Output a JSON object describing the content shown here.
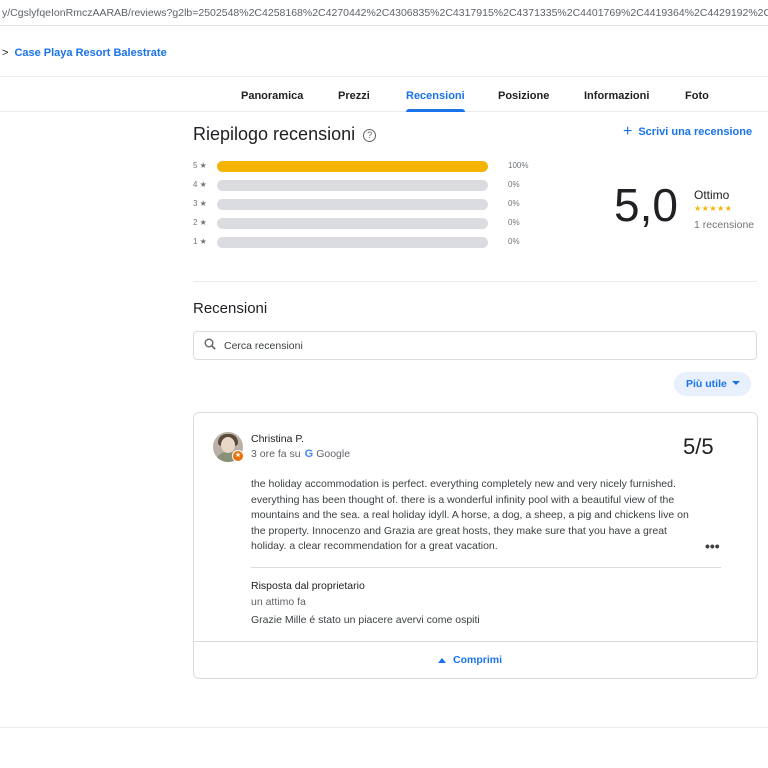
{
  "browser": {
    "url": "y/CgslyfqeIonRmczAARAB/reviews?g2lb=2502548%2C4258168%2C4270442%2C4306835%2C4317915%2C4371335%2C4401769%2C4419364%2C4429192%2C448"
  },
  "breadcrumb": {
    "separator": ">",
    "label": "Case Playa Resort Balestrate"
  },
  "tabs": [
    {
      "label": "Panoramica",
      "active": false
    },
    {
      "label": "Prezzi",
      "active": false
    },
    {
      "label": "Recensioni",
      "active": true
    },
    {
      "label": "Posizione",
      "active": false
    },
    {
      "label": "Informazioni",
      "active": false
    },
    {
      "label": "Foto",
      "active": false
    }
  ],
  "summary": {
    "title": "Riepilogo recensioni",
    "help_icon": "?",
    "write_review_label": "Scrivi una recensione",
    "histogram": [
      {
        "stars": "5",
        "percent": 100,
        "label": "100%"
      },
      {
        "stars": "4",
        "percent": 0,
        "label": "0%"
      },
      {
        "stars": "3",
        "percent": 0,
        "label": "0%"
      },
      {
        "stars": "2",
        "percent": 0,
        "label": "0%"
      },
      {
        "stars": "1",
        "percent": 0,
        "label": "0%"
      }
    ],
    "star_glyph": "★",
    "average": "5,0",
    "rating_word": "Ottimo",
    "stars": "★★★★★",
    "count": "1 recensione"
  },
  "reviews_section": {
    "title": "Recensioni",
    "search_placeholder": "Cerca recensioni",
    "sort_label": "Più utile"
  },
  "review": {
    "author": "Christina P.",
    "time": "3 ore fa su",
    "source_icon": "G",
    "source": "Google",
    "score": "5/5",
    "text": "the holiday accommodation is perfect. everything completely new and very nicely furnished. everything has been thought of. there is a wonderful infinity pool with a beautiful view of the mountains and the sea. a real holiday idyll. A horse, a dog, a sheep, a pig and chickens live on the property. Innocenzo and Grazia are great hosts, they make sure that you have a great holiday. a clear recommendation for a great vacation.",
    "more_icon": "•••",
    "reply_title": "Risposta dal proprietario",
    "reply_time": "un attimo fa",
    "reply_text": "Grazie Mille é stato un piacere avervi come ospiti",
    "collapse_label": "Comprimi"
  },
  "colors": {
    "accent": "#1a73e8",
    "star": "#f4b400",
    "bar_empty": "#dadce0"
  }
}
